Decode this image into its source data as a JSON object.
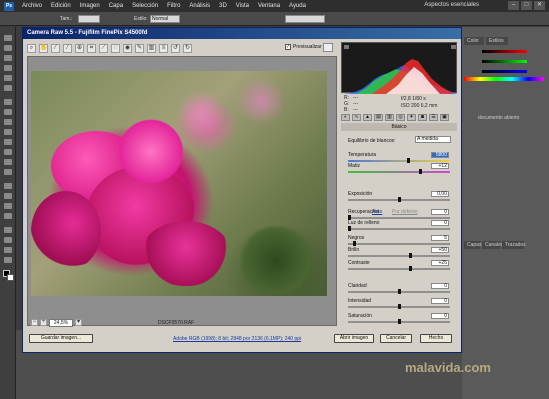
{
  "menubar": {
    "items": [
      "Archivo",
      "Edición",
      "Imagen",
      "Capa",
      "Selección",
      "Filtro",
      "Análisis",
      "3D",
      "Vista",
      "Ventana",
      "Ayuda"
    ],
    "workspace": "Aspectos esenciales",
    "controls": [
      "–",
      "□",
      "✕"
    ]
  },
  "options_bar": {
    "size_label": "Tam.:",
    "style_label": "Estilo:",
    "style_value": "Normal"
  },
  "right_panels": {
    "tab_color": "Color",
    "tab_styles": "Estilos",
    "doc_hint": "documento abierto",
    "tab_layers": "Capas",
    "tab_channels": "Canales",
    "tab_paths": "Trazados"
  },
  "camera_raw": {
    "title": "Camera Raw 5.5  -  Fujifilm FinePix S4500fd",
    "preview_label": "Previsualizar",
    "preview_checked": "✓",
    "zoom_value": "24,5%",
    "filename": "DSCF0570.RAF",
    "histogram": {
      "r_label": "R:",
      "g_label": "G:",
      "b_label": "B:",
      "r_value": "---",
      "g_value": "---",
      "b_value": "---",
      "aperture_shutter": "f/2,8   1/80 s",
      "iso_focal": "ISO 200   6,2 mm"
    },
    "panel_title": "Básico",
    "white_balance_label": "Equilibrio de blancos:",
    "white_balance_value": "A medida",
    "auto_link": "Auto",
    "default_link": "Por defecto",
    "sliders": [
      {
        "label": "Temperatura",
        "value": "5800",
        "pos": 0.6
      },
      {
        "label": "Matiz",
        "value": "+12",
        "pos": 0.72
      },
      {
        "label": "Exposición",
        "value": "0,00",
        "pos": 0.5
      },
      {
        "label": "Recuperación",
        "value": "0",
        "pos": 0.0
      },
      {
        "label": "Luz de relleno",
        "value": "0",
        "pos": 0.0
      },
      {
        "label": "Negros",
        "value": "5",
        "pos": 0.05
      },
      {
        "label": "Brillo",
        "value": "+50",
        "pos": 0.62
      },
      {
        "label": "Contraste",
        "value": "+25",
        "pos": 0.62
      },
      {
        "label": "Claridad",
        "value": "0",
        "pos": 0.5
      },
      {
        "label": "Intensidad",
        "value": "0",
        "pos": 0.5
      },
      {
        "label": "Saturación",
        "value": "0",
        "pos": 0.5
      }
    ],
    "buttons": {
      "save": "Guardar imagen...",
      "open": "Abrir imagen",
      "cancel": "Cancelar",
      "done": "Hecho"
    },
    "workflow_options": "Adobe RGB (1998); 8 bit; 2848 por 2136 (6,1MP); 240 ppi"
  },
  "watermark": "malavida.com",
  "colors": {
    "title_bar": "#0a246a",
    "dialog_bg": "#d4d0c8",
    "selected_value": "#316ac5"
  }
}
